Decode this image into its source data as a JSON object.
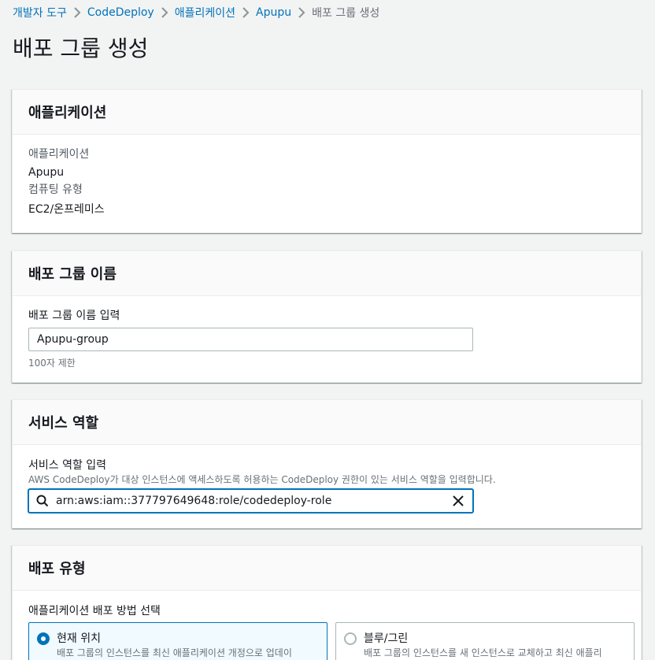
{
  "breadcrumb": {
    "items": [
      "개발자 도구",
      "CodeDeploy",
      "애플리케이션",
      "Apupu",
      "배포 그룹 생성"
    ]
  },
  "page_title": "배포 그룹 생성",
  "application_panel": {
    "title": "애플리케이션",
    "app_label": "애플리케이션",
    "app_value": "Apupu",
    "compute_label": "컴퓨팅 유형",
    "compute_value": "EC2/온프레미스"
  },
  "group_name_panel": {
    "title": "배포 그룹 이름",
    "input_label": "배포 그룹 이름 입력",
    "input_value": "Apupu-group",
    "constraint": "100자 제한"
  },
  "service_role_panel": {
    "title": "서비스 역할",
    "input_label": "서비스 역할 입력",
    "description": "AWS CodeDeploy가 대상 인스턴스에 액세스하도록 허용하는 CodeDeploy 권한이 있는 서비스 역할을 입력합니다.",
    "input_value": "arn:aws:iam::377797649648:role/codedeploy-role"
  },
  "deployment_type_panel": {
    "title": "배포 유형",
    "method_label": "애플리케이션 배포 방법 선택",
    "options": [
      {
        "title": "현재 위치",
        "description": "배포 그룹의 인스턴스를 최신 애플리케이션 개정으로 업데이",
        "selected": true
      },
      {
        "title": "블루/그린",
        "description": "배포 그룹의 인스턴스를 새 인스턴스로 교체하고 최신 애플리",
        "selected": false
      }
    ]
  },
  "colors": {
    "link": "#0073bb",
    "background": "#f2f3f3",
    "selected_tile": "#f1faff"
  }
}
